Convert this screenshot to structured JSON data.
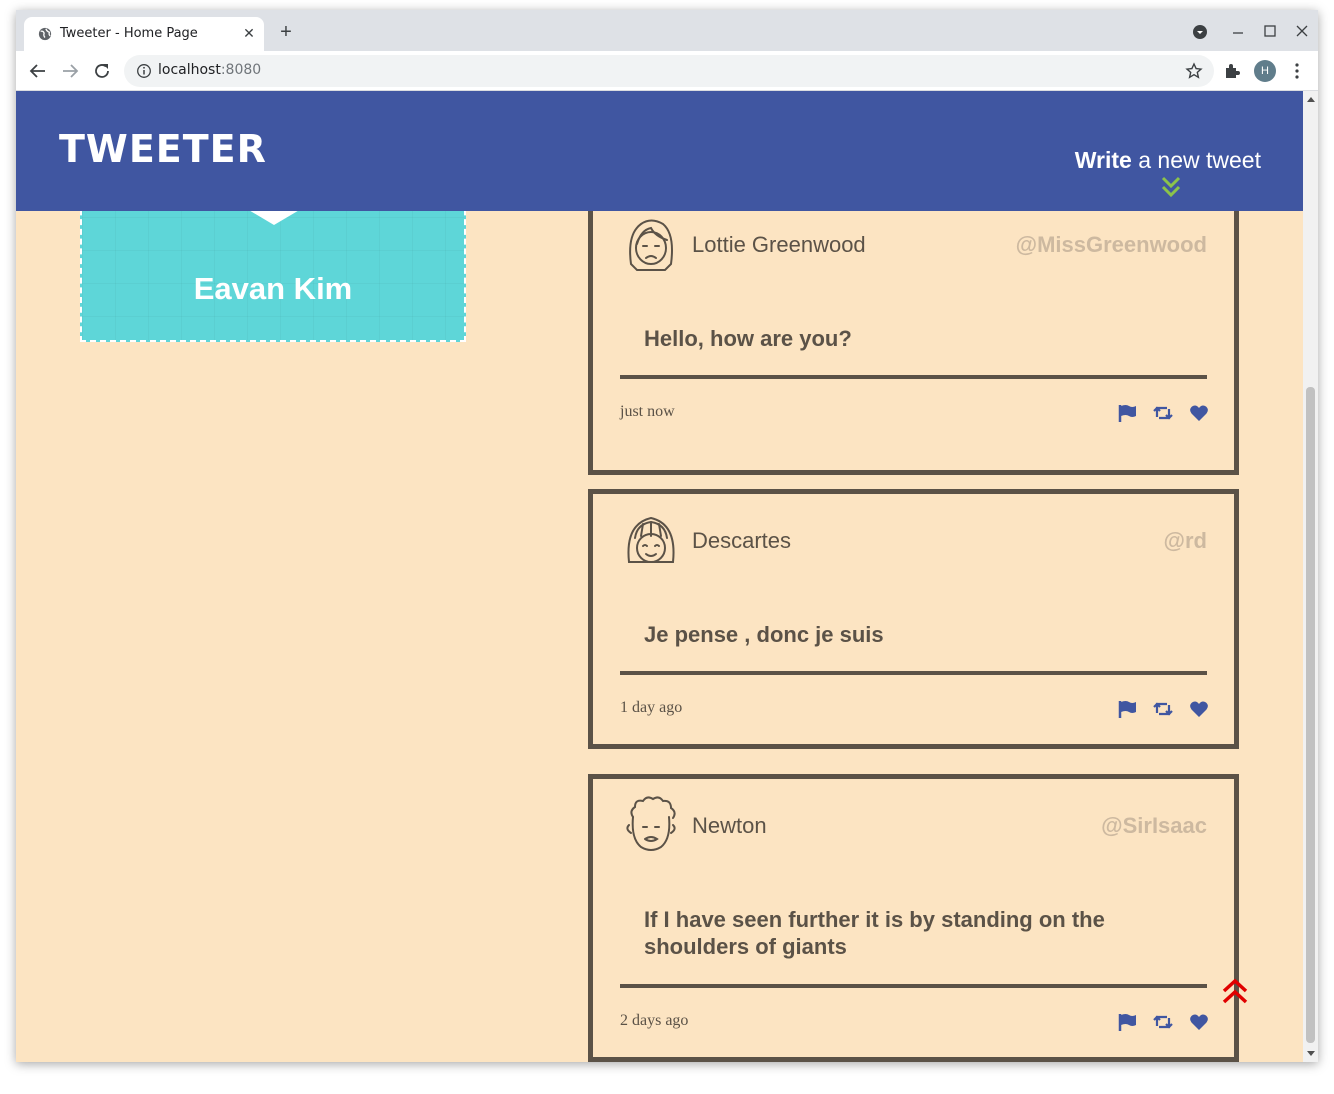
{
  "browser": {
    "tab_title": "Tweeter - Home Page",
    "url_host": "localhost",
    "url_port": ":8080",
    "avatar_letter": "H"
  },
  "colors": {
    "nav_bg": "#4056a1",
    "page_bg": "#fce4c2",
    "profile_bg": "#5ed6d8",
    "text_dark": "#5b5247",
    "handle": "#cdb9a0",
    "action_icon": "#4056a1",
    "chevron_down": "#8bc34a",
    "back_to_top": "#e00000"
  },
  "nav": {
    "logo": "TWEETER",
    "write_bold": "Write",
    "write_rest": " a new tweet"
  },
  "profile": {
    "name": "Eavan Kim"
  },
  "tweets": [
    {
      "name": "Lottie Greenwood",
      "handle": "@MissGreenwood",
      "content": "Hello, how are you?",
      "time": "just now",
      "avatar": "girl-frown-avatar-icon"
    },
    {
      "name": "Descartes",
      "handle": "@rd",
      "content": "Je pense , donc je suis",
      "time": "1 day ago",
      "avatar": "girl-bangs-avatar-icon"
    },
    {
      "name": "Newton",
      "handle": "@SirIsaac",
      "content": "If I have seen further it is by standing on the shoulders of giants",
      "time": "2 days ago",
      "avatar": "curly-hair-avatar-icon"
    }
  ],
  "icons": {
    "flag": "flag-icon",
    "retweet": "retweet-icon",
    "like": "heart-icon",
    "write_toggle": "double-chevron-down-icon",
    "back_to_top": "double-chevron-up-icon"
  }
}
